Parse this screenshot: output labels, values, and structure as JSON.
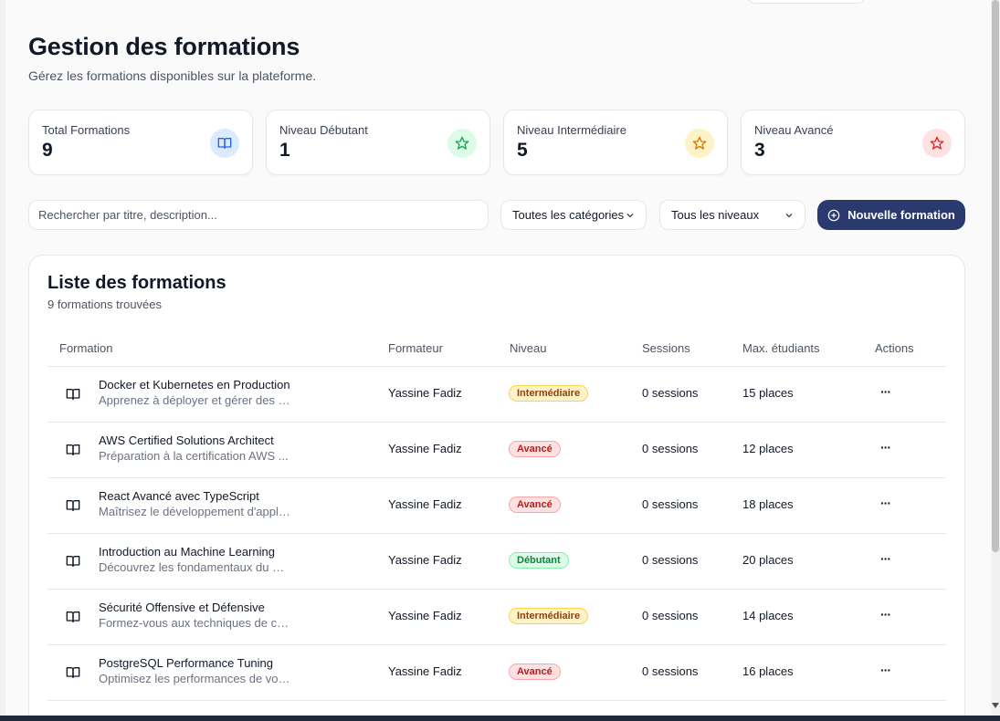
{
  "header": {
    "title": "Gestion des formations",
    "subtitle": "Gérez les formations disponibles sur la plateforme."
  },
  "stats": [
    {
      "label": "Total Formations",
      "value": "9",
      "icon": "book-icon",
      "color": "#2563eb",
      "bg": "#dbeafe"
    },
    {
      "label": "Niveau Débutant",
      "value": "1",
      "icon": "star-icon",
      "color": "#16a34a",
      "bg": "#dcfce7"
    },
    {
      "label": "Niveau Intermédiaire",
      "value": "5",
      "icon": "star-icon",
      "color": "#d97706",
      "bg": "#fef3c7"
    },
    {
      "label": "Niveau Avancé",
      "value": "3",
      "icon": "star-icon",
      "color": "#dc2626",
      "bg": "#fee2e2"
    }
  ],
  "filters": {
    "search_placeholder": "Rechercher par titre, description...",
    "category": "Toutes les catégories",
    "level": "Tous les niveaux",
    "new_button": "Nouvelle formation"
  },
  "list": {
    "title": "Liste des formations",
    "count": "9 formations trouvées",
    "columns": [
      "Formation",
      "Formateur",
      "Niveau",
      "Sessions",
      "Max. étudiants",
      "Actions"
    ],
    "rows": [
      {
        "title": "Docker et Kubernetes en Production",
        "desc": "Apprenez à déployer et gérer des a...",
        "trainer": "Yassine Fadiz",
        "level": "Intermédiaire",
        "level_kind": "inter",
        "sessions": "0 sessions",
        "max": "15 places"
      },
      {
        "title": "AWS Certified Solutions Architect",
        "desc": "Préparation à la certification AWS ...",
        "trainer": "Yassine Fadiz",
        "level": "Avancé",
        "level_kind": "av",
        "sessions": "0 sessions",
        "max": "12 places"
      },
      {
        "title": "React Avancé avec TypeScript",
        "desc": "Maîtrisez le développement d'appli...",
        "trainer": "Yassine Fadiz",
        "level": "Avancé",
        "level_kind": "av",
        "sessions": "0 sessions",
        "max": "18 places"
      },
      {
        "title": "Introduction au Machine Learning",
        "desc": "Découvrez les fondamentaux du m...",
        "trainer": "Yassine Fadiz",
        "level": "Débutant",
        "level_kind": "deb",
        "sessions": "0 sessions",
        "max": "20 places"
      },
      {
        "title": "Sécurité Offensive et Défensive",
        "desc": "Formez-vous aux techniques de cy...",
        "trainer": "Yassine Fadiz",
        "level": "Intermédiaire",
        "level_kind": "inter",
        "sessions": "0 sessions",
        "max": "14 places"
      },
      {
        "title": "PostgreSQL Performance Tuning",
        "desc": "Optimisez les performances de vos...",
        "trainer": "Yassine Fadiz",
        "level": "Avancé",
        "level_kind": "av",
        "sessions": "0 sessions",
        "max": "16 places"
      }
    ],
    "actions_glyph": "···"
  }
}
